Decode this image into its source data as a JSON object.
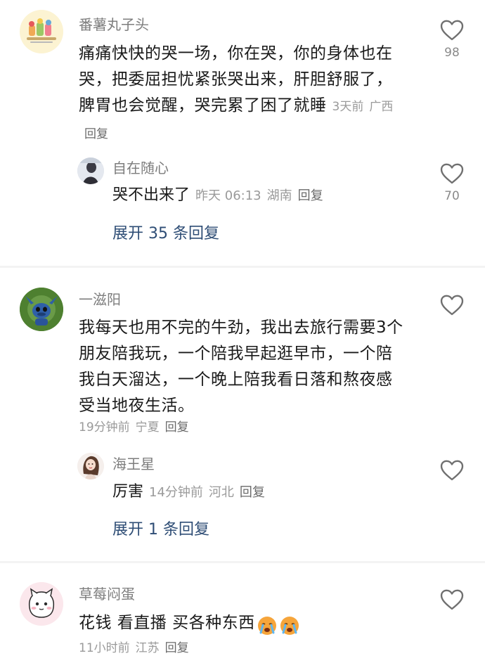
{
  "comments": [
    {
      "username": "番薯丸子头",
      "text": "痛痛快快的哭一场，你在哭，你的身体也在哭，把委屈担忧紧张哭出来，肝胆舒服了，脾胃也会觉醒，哭完累了困了就睡",
      "time": "3天前",
      "location": "广西",
      "reply_label": "回复",
      "likes": "98",
      "sub_reply": {
        "username": "自在随心",
        "text": "哭不出来了",
        "time": "昨天 06:13",
        "location": "湖南",
        "reply_label": "回复",
        "likes": "70"
      },
      "expand_label": "展开 35 条回复"
    },
    {
      "username": "一滋阳",
      "text": "我每天也用不完的牛劲，我出去旅行需要3个朋友陪我玩，一个陪我早起逛早市，一个陪我白天溜达，一个晚上陪我看日落和熬夜感受当地夜生活。",
      "time": "19分钟前",
      "location": "宁夏",
      "reply_label": "回复",
      "likes": "",
      "sub_reply": {
        "username": "海王星",
        "text": "厉害",
        "time": "14分钟前",
        "location": "河北",
        "reply_label": "回复",
        "likes": ""
      },
      "expand_label": "展开 1 条回复"
    },
    {
      "username": "草莓闷蛋",
      "text": "花钱 看直播 买各种东西",
      "emoji": [
        "crying-face-emoji",
        "crying-face-emoji"
      ],
      "time": "11小时前",
      "location": "江苏",
      "reply_label": "回复",
      "likes": ""
    }
  ],
  "colors": {
    "username": "#7d7d7d",
    "meta": "#9a9a9a",
    "expand_link": "#2e4d75",
    "divider": "#f3f3f3",
    "heart_outline": "#707070"
  }
}
